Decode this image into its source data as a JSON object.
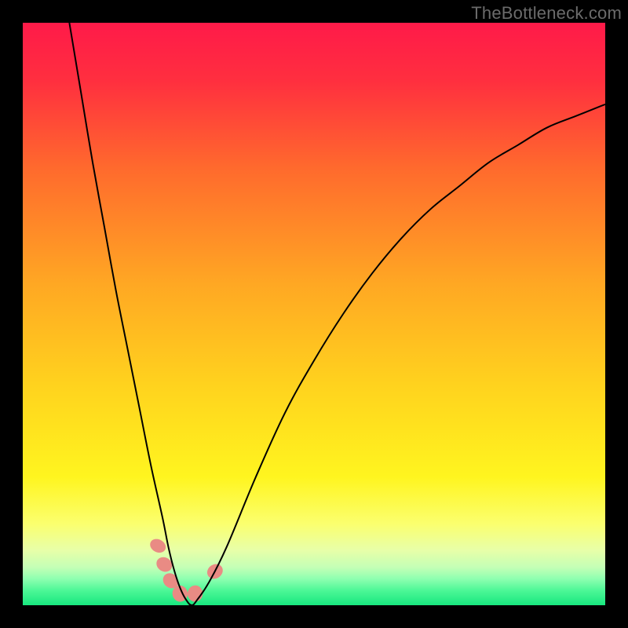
{
  "watermark": "TheBottleneck.com",
  "chart_data": {
    "type": "line",
    "title": "",
    "xlabel": "",
    "ylabel": "",
    "xlim": [
      0,
      100
    ],
    "ylim": [
      0,
      100
    ],
    "grid": false,
    "legend": false,
    "background_gradient_stops": [
      {
        "offset": 0.0,
        "color": "#ff1a49"
      },
      {
        "offset": 0.1,
        "color": "#ff2f3f"
      },
      {
        "offset": 0.25,
        "color": "#ff6a2d"
      },
      {
        "offset": 0.45,
        "color": "#ffa823"
      },
      {
        "offset": 0.62,
        "color": "#ffd21e"
      },
      {
        "offset": 0.78,
        "color": "#fff51f"
      },
      {
        "offset": 0.86,
        "color": "#fbff6e"
      },
      {
        "offset": 0.905,
        "color": "#e8ffa8"
      },
      {
        "offset": 0.935,
        "color": "#c4ffb6"
      },
      {
        "offset": 0.955,
        "color": "#8dffb0"
      },
      {
        "offset": 0.975,
        "color": "#4cf796"
      },
      {
        "offset": 1.0,
        "color": "#18e77f"
      }
    ],
    "series": [
      {
        "name": "bottleneck-curve",
        "color": "#000000",
        "x": [
          8,
          10,
          12,
          14,
          16,
          18,
          20,
          22,
          24,
          25,
          26,
          27,
          28,
          29,
          30,
          32,
          35,
          40,
          45,
          50,
          55,
          60,
          65,
          70,
          75,
          80,
          85,
          90,
          95,
          100
        ],
        "y": [
          100,
          88,
          76,
          65,
          54,
          44,
          34,
          24,
          15,
          10,
          6,
          3,
          1,
          0,
          1,
          4,
          10,
          22,
          33,
          42,
          50,
          57,
          63,
          68,
          72,
          76,
          79,
          82,
          84,
          86
        ]
      }
    ],
    "markers": [
      {
        "name": "pink-marker-1",
        "x": 23.2,
        "y": 10.2,
        "r": 1.4,
        "length": 2.2,
        "angle_deg": -62,
        "color": "#e98b84"
      },
      {
        "name": "pink-marker-2",
        "x": 24.3,
        "y": 7.0,
        "r": 1.4,
        "length": 2.4,
        "angle_deg": -58,
        "color": "#e98b84"
      },
      {
        "name": "pink-marker-3",
        "x": 25.4,
        "y": 4.2,
        "r": 1.4,
        "length": 2.4,
        "angle_deg": -50,
        "color": "#e98b84"
      },
      {
        "name": "pink-marker-4",
        "x": 27.0,
        "y": 2.0,
        "r": 1.4,
        "length": 2.6,
        "angle_deg": -10,
        "color": "#e98b84"
      },
      {
        "name": "pink-marker-5",
        "x": 29.6,
        "y": 2.0,
        "r": 1.4,
        "length": 2.6,
        "angle_deg": 5,
        "color": "#e98b84"
      },
      {
        "name": "pink-marker-6",
        "x": 33.0,
        "y": 5.8,
        "r": 1.4,
        "length": 2.4,
        "angle_deg": 55,
        "color": "#e98b84"
      }
    ]
  }
}
